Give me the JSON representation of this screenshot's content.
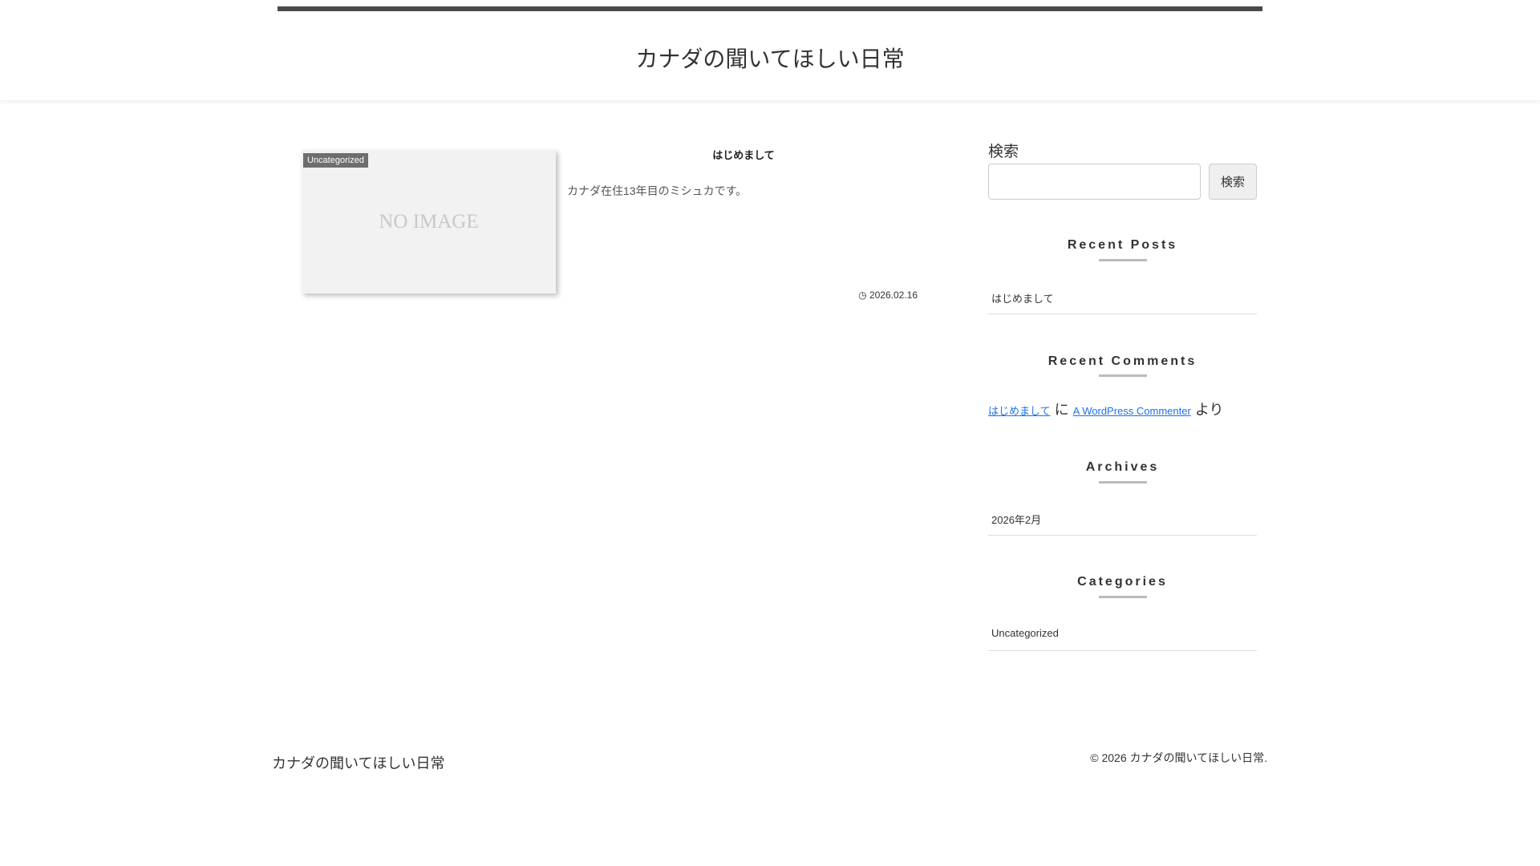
{
  "header": {
    "site_title": "カナダの聞いてほしい日常"
  },
  "post": {
    "category": "Uncategorized",
    "thumbnail_text": "NO IMAGE",
    "title": "はじめまして",
    "excerpt": "カナダ在住13年目のミシュカです。",
    "date": "2026.02.16"
  },
  "sidebar": {
    "search": {
      "label": "検索",
      "button": "検索",
      "placeholder": "",
      "value": ""
    },
    "recent_posts": {
      "title": "Recent Posts",
      "items": [
        "はじめまして"
      ]
    },
    "recent_comments": {
      "title": "Recent Comments",
      "post_link": "はじめまして",
      "ni": "に",
      "author": "A WordPress Commenter",
      "yori": "より"
    },
    "archives": {
      "title": "Archives",
      "items": [
        "2026年2月"
      ]
    },
    "categories": {
      "title": "Categories",
      "items": [
        "Uncategorized"
      ]
    }
  },
  "footer": {
    "site_title": "カナダの聞いてほしい日常",
    "copyright": "© 2026 カナダの聞いてほしい日常."
  }
}
